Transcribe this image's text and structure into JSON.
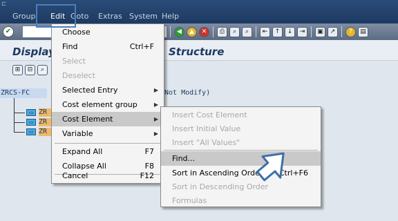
{
  "menubar": {
    "items": [
      {
        "label": "Group"
      },
      {
        "label": "Edit"
      },
      {
        "label": "Goto"
      },
      {
        "label": "Extras"
      },
      {
        "label": "System"
      },
      {
        "label": "Help"
      }
    ]
  },
  "icons": {
    "enter": "check-icon",
    "back": "back-icon",
    "exit": "exit-icon",
    "cancel": "cancel-icon",
    "print": "print-icon",
    "find": "find-icon",
    "find_next": "find-next-icon",
    "first_page": "first-page-icon",
    "prev_page": "previous-page-icon",
    "next_page": "next-page-icon",
    "last_page": "last-page-icon",
    "new_session": "new-session-icon",
    "shortcut": "shortcut-icon",
    "help": "help-icon",
    "layout": "customize-layout-icon"
  },
  "page": {
    "title_part1": "Display",
    "title_part2": "Structure"
  },
  "tree": {
    "root": "ZRCS-FC",
    "root_tail": "Not Modify)",
    "nodes": [
      "ZR",
      "ZR",
      "ZR"
    ]
  },
  "edit_menu": {
    "items": [
      {
        "label": "Choose",
        "shortcut": "",
        "disabled": false
      },
      {
        "label": "Find",
        "shortcut": "Ctrl+F",
        "disabled": false
      },
      {
        "label": "Select",
        "shortcut": "",
        "disabled": true
      },
      {
        "label": "Deselect",
        "shortcut": "",
        "disabled": true
      },
      {
        "label": "Selected Entry",
        "shortcut": "",
        "disabled": false
      },
      {
        "label": "Cost element group",
        "shortcut": "",
        "disabled": false
      },
      {
        "label": "Cost Element",
        "shortcut": "",
        "disabled": false
      },
      {
        "label": "Variable",
        "shortcut": "",
        "disabled": false
      },
      {
        "label": "Expand All",
        "shortcut": "F7",
        "disabled": false
      },
      {
        "label": "Collapse All",
        "shortcut": "F8",
        "disabled": false
      },
      {
        "label": "Cancel",
        "shortcut": "F12",
        "disabled": false
      }
    ]
  },
  "cost_element_menu": {
    "items": [
      {
        "label": "Insert Cost Element",
        "shortcut": "",
        "disabled": true
      },
      {
        "label": "Insert Initial Value",
        "shortcut": "",
        "disabled": true
      },
      {
        "label": "Insert \"All Values\"",
        "shortcut": "",
        "disabled": true
      },
      {
        "label": "Find...",
        "shortcut": "",
        "disabled": false
      },
      {
        "label": "Sort in Ascending Order",
        "shortcut": "Ctrl+F6",
        "disabled": false
      },
      {
        "label": "Sort in Descending Order",
        "shortcut": "",
        "disabled": true
      },
      {
        "label": "Formulas",
        "shortcut": "",
        "disabled": true
      }
    ]
  },
  "colors": {
    "menubar": "#1d3a62",
    "menu_highlight": "#c9c9c9",
    "tree_root": "#c9d9ef",
    "tree_node": "#f0b86a"
  }
}
